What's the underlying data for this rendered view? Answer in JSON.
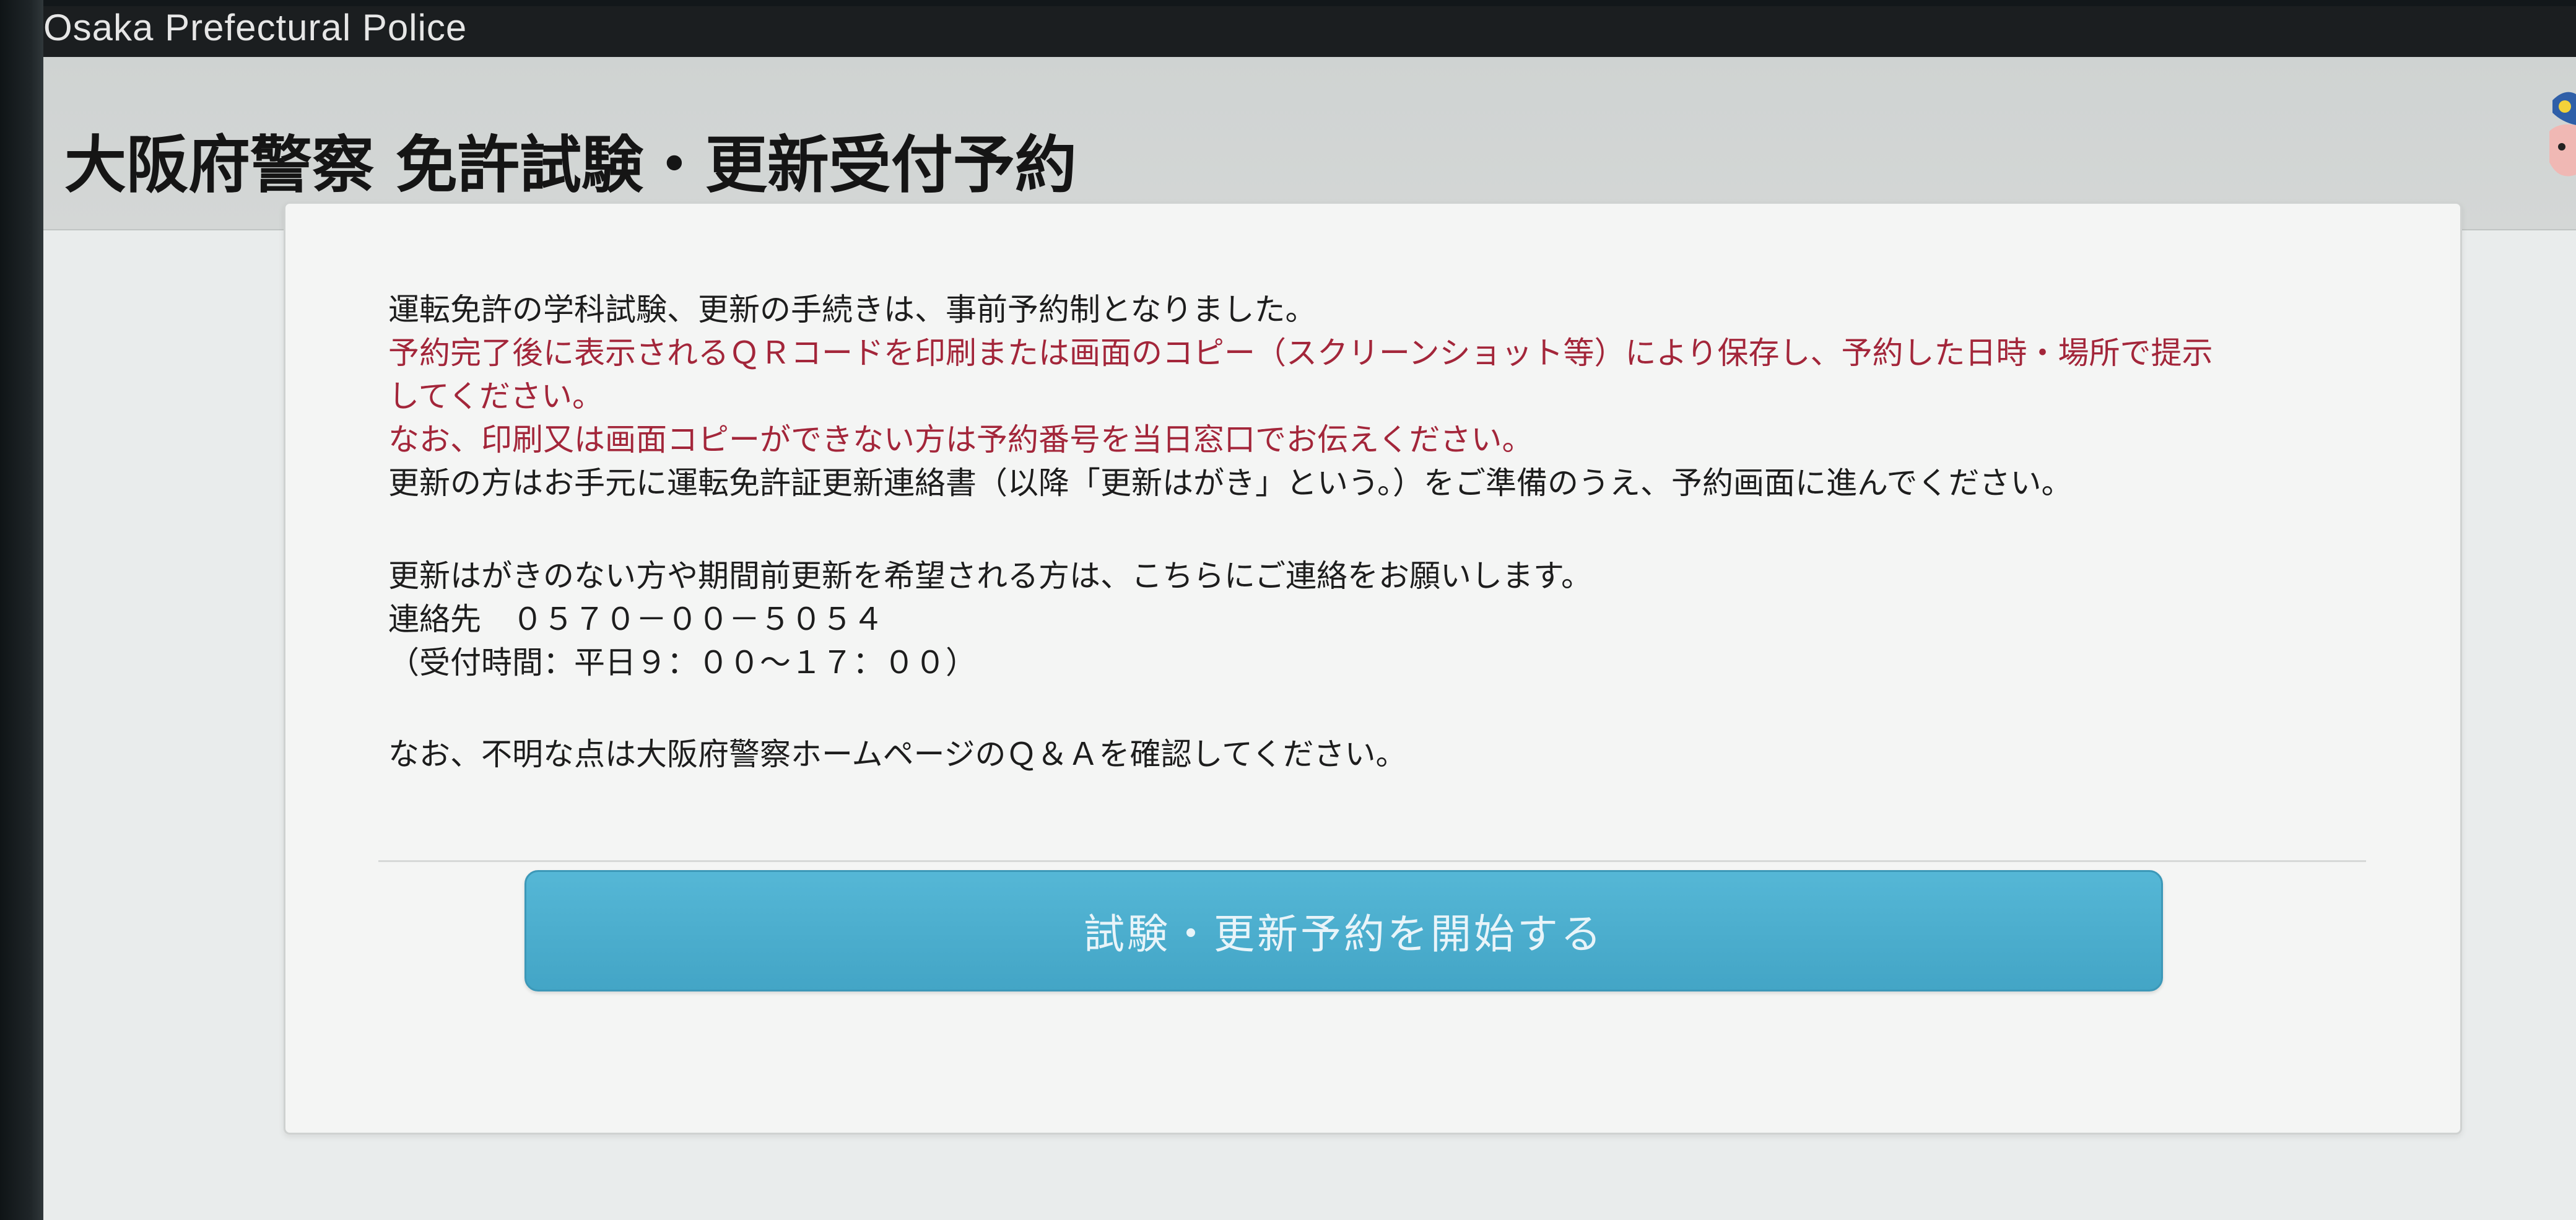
{
  "brand": {
    "name": "Osaka Prefectural Police"
  },
  "header": {
    "title": "大阪府警察 免許試験・更新受付予約"
  },
  "notice": {
    "line1": "運転免許の学科試験、更新の手続きは、事前予約制となりました。",
    "line2": "予約完了後に表示されるＱＲコードを印刷または画面のコピー（スクリーンショット等）により保存し、予約した日時・場所で提示",
    "line3": "してください。",
    "line4": "なお、印刷又は画面コピーができない方は予約番号を当日窓口でお伝えください。",
    "line5": "更新の方はお手元に運転免許証更新連絡書（以降「更新はがき」という。）をご準備のうえ、予約画面に進んでください。",
    "line6": "更新はがきのない方や期間前更新を希望される方は、こちらにご連絡をお願いします。",
    "line7": "連絡先　０５７０－００－５０５４",
    "line8": "（受付時間：平日９：００～１７：００）",
    "line9": "なお、不明な点は大阪府警察ホームページのＱ＆Ａを確認してください。"
  },
  "actions": {
    "start_label": "試験・更新予約を開始する"
  },
  "colors": {
    "warning_text": "#a3263a",
    "button": "#4aadcd",
    "brand_bar": "#1b1e20"
  }
}
